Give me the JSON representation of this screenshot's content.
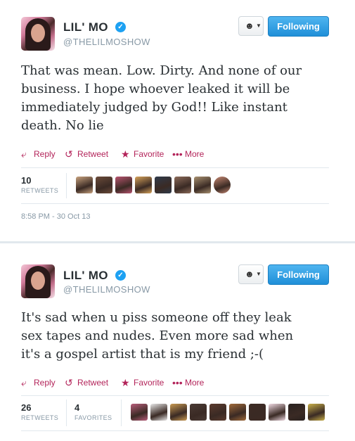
{
  "tweets": [
    {
      "name": "LIL' MO",
      "handle": "@THELILMOSHOW",
      "follow_label": "Following",
      "text_lines": [
        "That was mean. Low. Dirty. And none of our",
        "business. I hope whoever leaked it will be",
        "immediately judged by God!! Like instant",
        "death. No lie"
      ],
      "actions": {
        "reply": "Reply",
        "retweet": "Retweet",
        "favorite": "Favorite",
        "more": "More"
      },
      "stats": [
        {
          "count": "10",
          "label": "RETWEETS"
        }
      ],
      "timestamp": "8:58 PM - 30 Oct 13",
      "avatar_colors": [
        "#c8a27e",
        "#6b4b3a",
        "#b8546f",
        "#d6a25a",
        "#2f3a4a",
        "#8c6b5a",
        "#a89070",
        "#c98a74"
      ]
    },
    {
      "name": "LIL' MO",
      "handle": "@THELILMOSHOW",
      "follow_label": "Following",
      "text_lines": [
        "It's sad when u piss someone off they leak",
        "sex tapes and nudes. Even more sad when",
        "it's a gospel artist that is my friend ;-("
      ],
      "actions": {
        "reply": "Reply",
        "retweet": "Retweet",
        "favorite": "Favorite",
        "more": "More"
      },
      "stats": [
        {
          "count": "26",
          "label": "RETWEETS"
        },
        {
          "count": "4",
          "label": "FAVORITES"
        }
      ],
      "avatar_colors": [
        "#b85d7a",
        "#e8e8e8",
        "#c99a52",
        "#4a3a34",
        "#5b3b2e",
        "#a06a3a",
        "#3d2b24",
        "#efd9e2",
        "#2a2220",
        "#c9b04a"
      ]
    }
  ],
  "colors": {
    "accent": "#b3245a",
    "follow_blue": "#2b9de4",
    "verified": "#1da1f2"
  }
}
